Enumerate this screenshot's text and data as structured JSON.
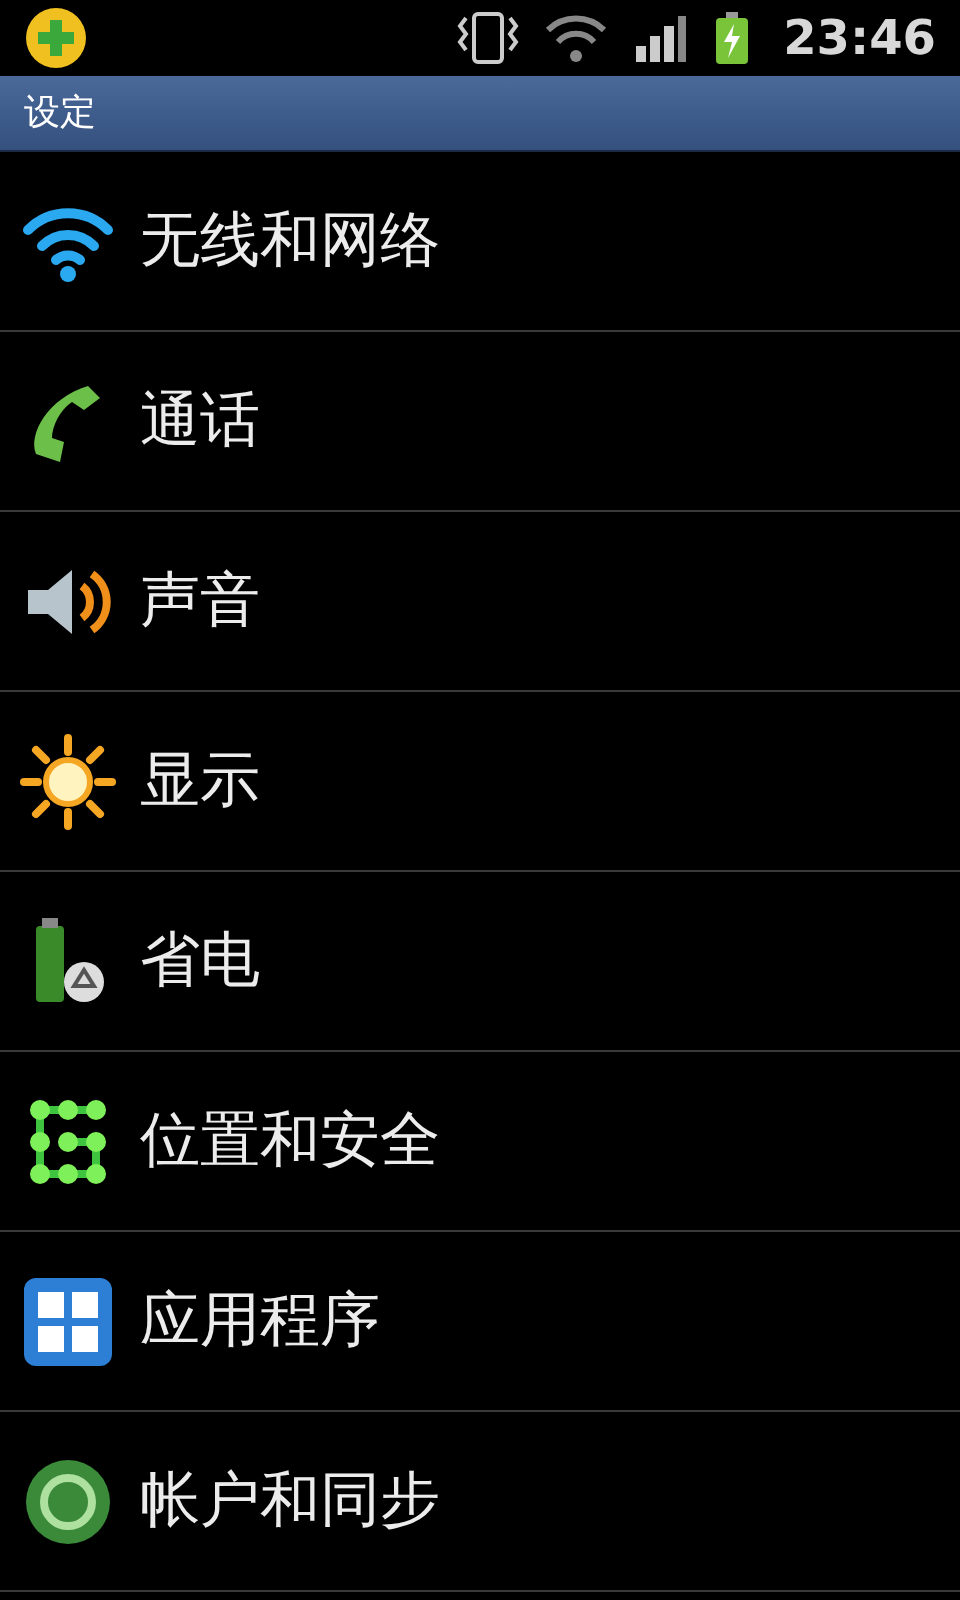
{
  "status_bar": {
    "time": "23:46"
  },
  "title_bar": {
    "title": "设定"
  },
  "items": [
    {
      "kind": "wifi",
      "label": "无线和网络"
    },
    {
      "kind": "phone",
      "label": "通话"
    },
    {
      "kind": "sound",
      "label": "声音"
    },
    {
      "kind": "display",
      "label": "显示"
    },
    {
      "kind": "power",
      "label": "省电"
    },
    {
      "kind": "location",
      "label": "位置和安全"
    },
    {
      "kind": "apps",
      "label": "应用程序"
    },
    {
      "kind": "sync",
      "label": "帐户和同步"
    }
  ]
}
